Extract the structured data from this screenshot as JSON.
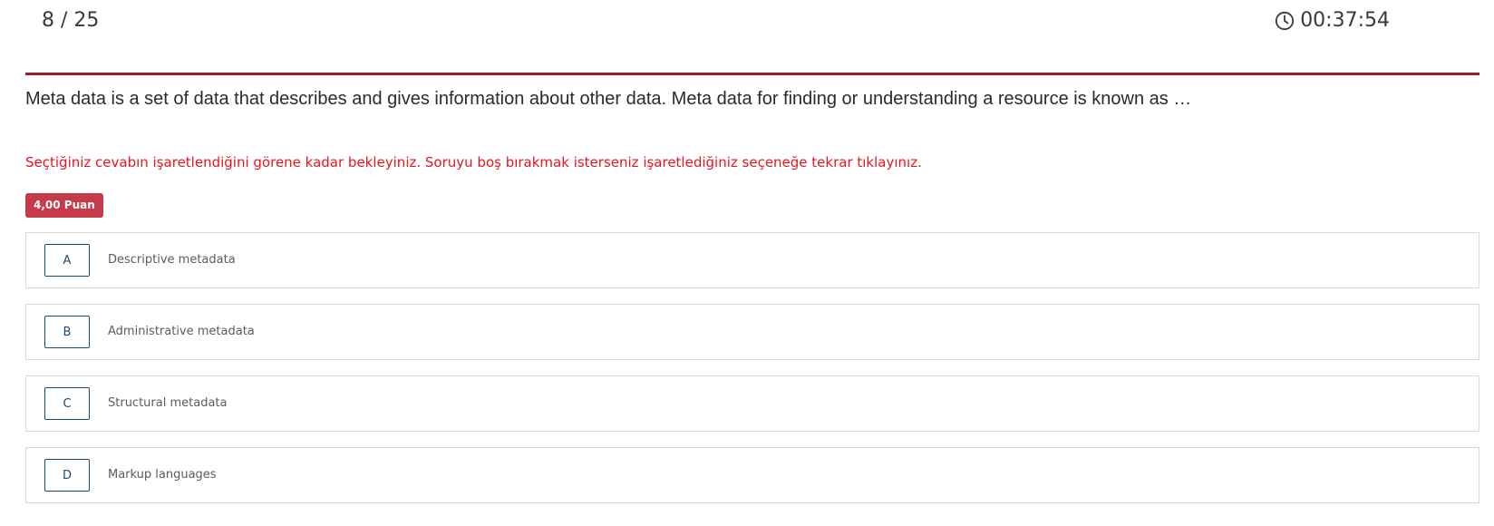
{
  "header": {
    "counter": "8 / 25",
    "timer": "00:37:54",
    "timer_icon": "clock-icon"
  },
  "question": {
    "text": "Meta data is a set of data that describes and gives information about other data. Meta data for finding or understanding a resource is known as …",
    "warning": "Seçtiğiniz cevabın işaretlendiğini görene kadar bekleyiniz. Soruyu boş bırakmak isterseniz işaretlediğiniz seçeneğe tekrar tıklayınız.",
    "points": "4,00 Puan"
  },
  "options": [
    {
      "letter": "A",
      "text": "Descriptive metadata"
    },
    {
      "letter": "B",
      "text": "Administrative metadata"
    },
    {
      "letter": "C",
      "text": "Structural metadata"
    },
    {
      "letter": "D",
      "text": "Markup languages"
    }
  ],
  "colors": {
    "accent": "#9e1b32",
    "warning": "#e8161c",
    "badge": "#c63a4a",
    "option_border": "#1f4a6e"
  }
}
